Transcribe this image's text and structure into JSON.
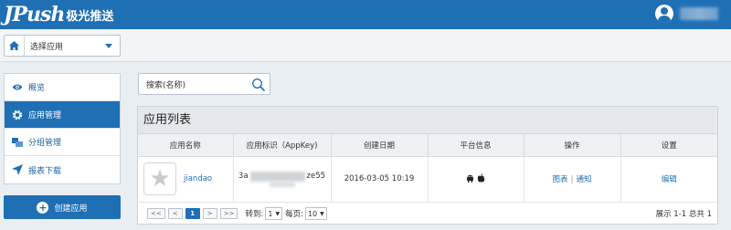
{
  "header": {
    "logo_text": "JPush",
    "logo_cn": "极光推送"
  },
  "app_selector": {
    "label": "选择应用"
  },
  "sidebar": {
    "items": [
      {
        "label": "概览",
        "icon": "eye-icon"
      },
      {
        "label": "应用管理",
        "icon": "gear-icon",
        "active": true
      },
      {
        "label": "分组管理",
        "icon": "group-icon"
      },
      {
        "label": "报表下载",
        "icon": "send-icon"
      }
    ],
    "create_label": "创建应用"
  },
  "search": {
    "value": "搜索(名称)"
  },
  "panel": {
    "title": "应用列表",
    "columns": [
      "应用名称",
      "应用标识（AppKey)",
      "创建日期",
      "平台信息",
      "操作",
      "设置"
    ],
    "rows": [
      {
        "app_name": "jiandao",
        "appkey_start": "3a",
        "appkey_end": "ze55",
        "created": "2016-03-05 10:19",
        "platforms": [
          "android-icon",
          "apple-icon"
        ],
        "actions": [
          "图表",
          "通知"
        ],
        "settings": "编辑"
      }
    ]
  },
  "pager": {
    "first": "<<",
    "prev": "<",
    "current": "1",
    "next": ">",
    "last": ">>",
    "goto_label": "转到:",
    "goto_value": "1",
    "per_page_label": "每页:",
    "per_page_value": "10",
    "info": "展示 1-1 总共 1"
  },
  "colors": {
    "brand": "#1f6fb5"
  }
}
